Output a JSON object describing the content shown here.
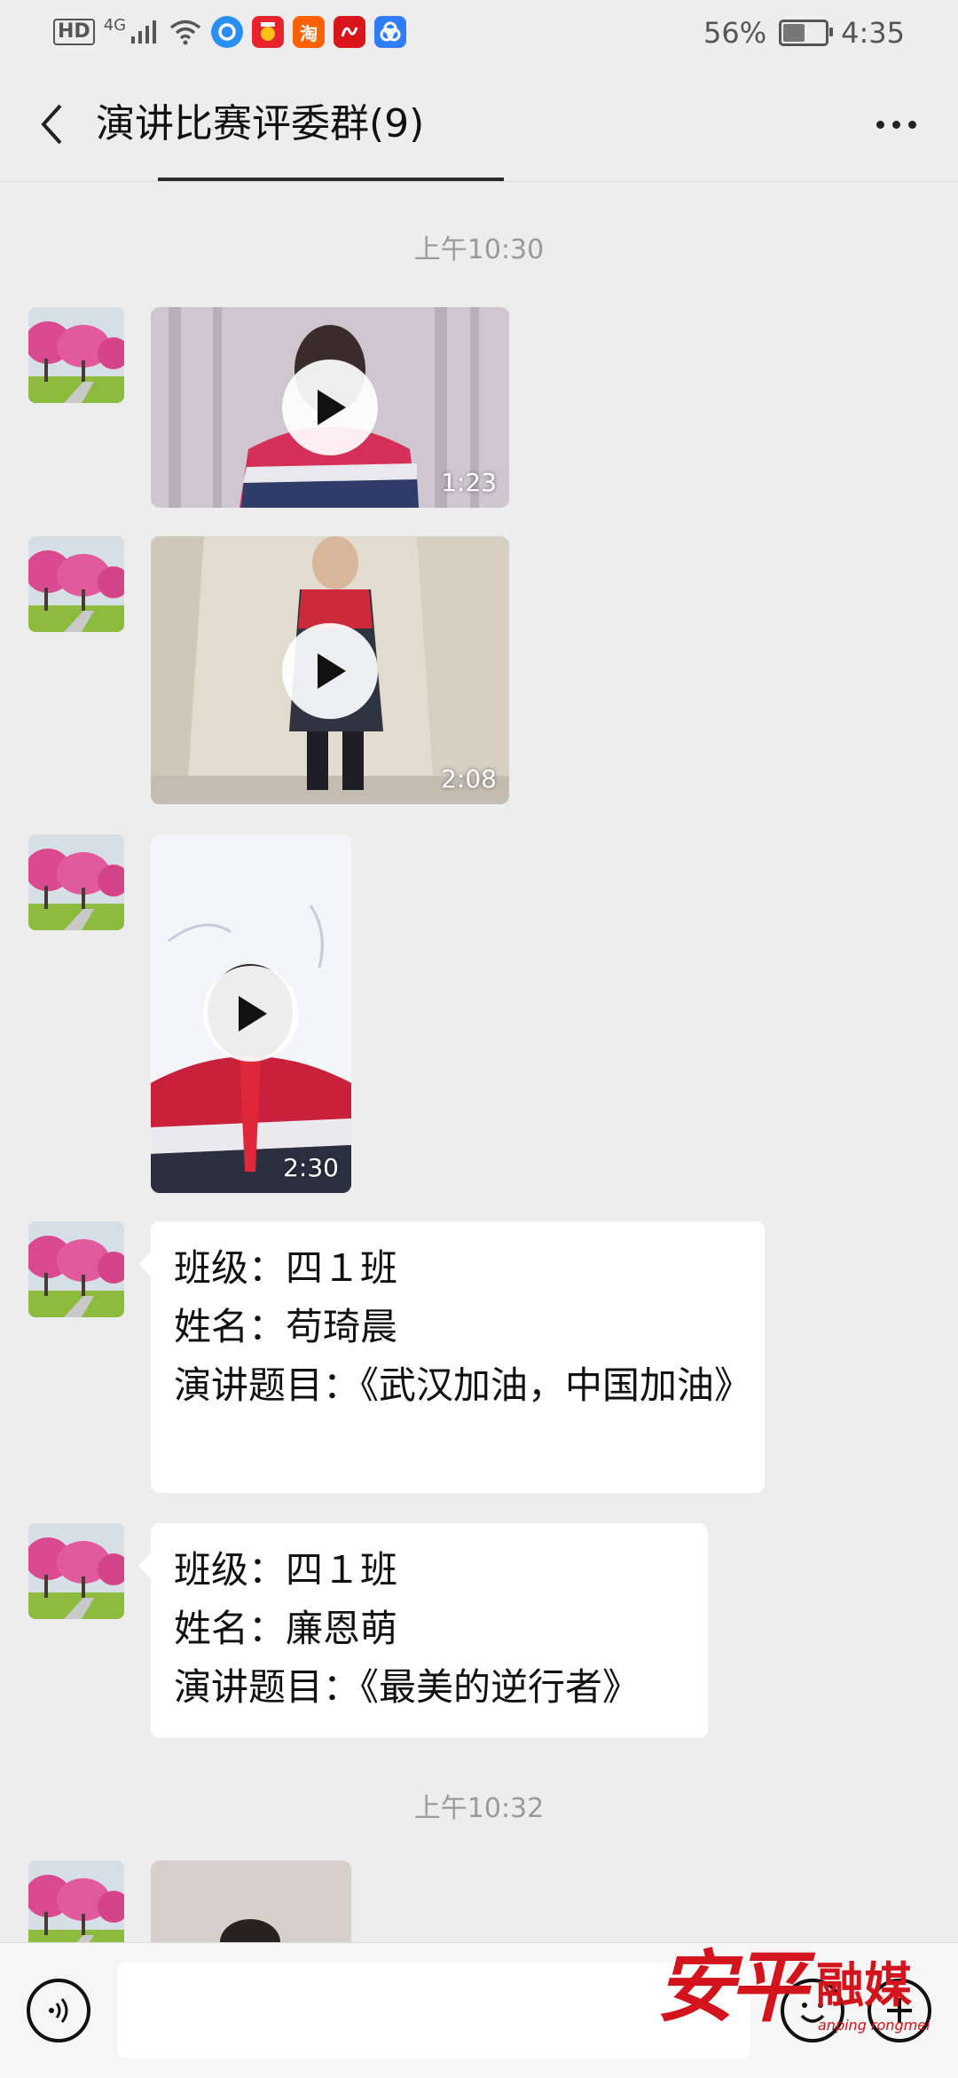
{
  "status_bar": {
    "hd": "HD",
    "network": "4G",
    "battery_percent": "56%",
    "battery_level": 0.56,
    "time": "4:35",
    "app_icons": [
      "qq-browser-icon",
      "news-app-icon",
      "taobao-icon",
      "app-icon",
      "baidu-netdisk-icon"
    ],
    "taobao_label": "淘"
  },
  "nav": {
    "title": "演讲比赛评委群(9)"
  },
  "messages": {
    "time_1": "上午10:30",
    "video_1_duration": "1:23",
    "video_2_duration": "2:08",
    "video_3_duration": "2:30",
    "text_1": {
      "line1": "班级：四１班",
      "line2": "姓名：苟琦晨",
      "line3": "演讲题目：《武汉加油，中国加油》"
    },
    "text_2": {
      "line1": "班级：四１班",
      "line2": "姓名：廉恩萌",
      "line3": "演讲题目：《最美的逆行者》"
    },
    "time_2": "上午10:32"
  },
  "watermark": {
    "main": "安平",
    "side": "融媒",
    "sub": "anping rongmei"
  },
  "colors": {
    "background": "#ededed",
    "bubble": "#ffffff",
    "timestamp": "#9a9a9a",
    "watermark": "#d4141c"
  }
}
